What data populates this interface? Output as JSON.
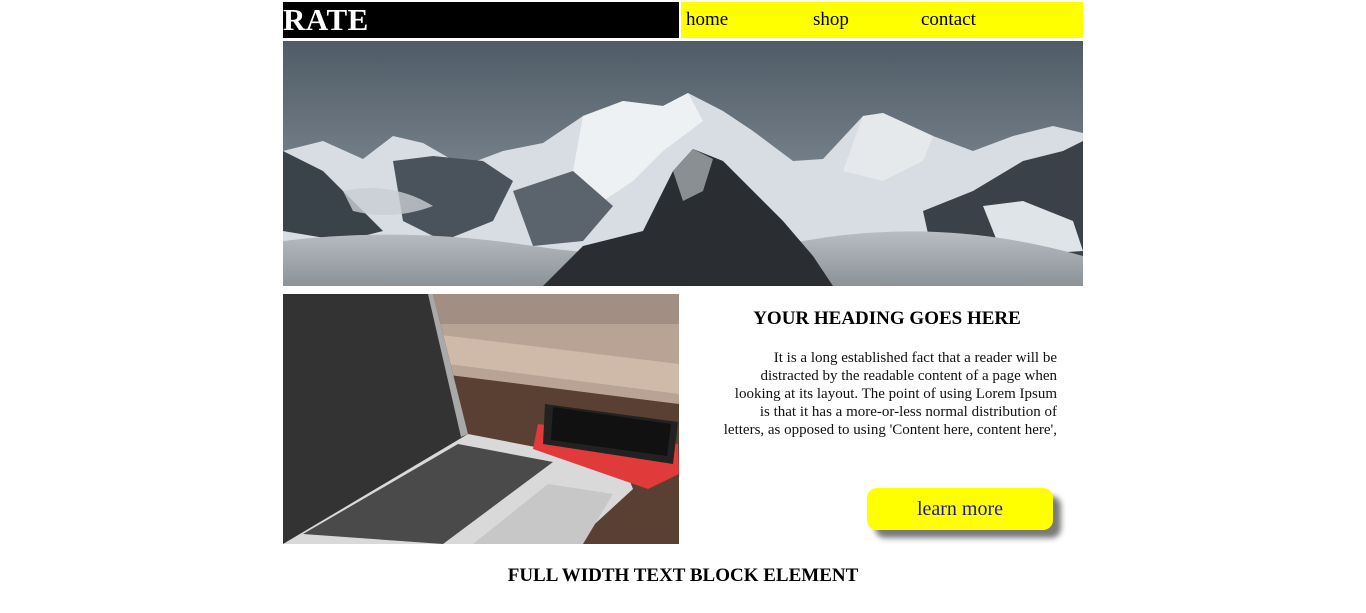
{
  "brand": {
    "logo_text": "RATE"
  },
  "nav": {
    "items": [
      {
        "label": "home"
      },
      {
        "label": "shop"
      },
      {
        "label": "contact"
      }
    ]
  },
  "hero": {
    "image": "snowy-mountains-photo"
  },
  "feature": {
    "image": "laptop-and-phone-photo",
    "heading": "YOUR HEADING GOES HERE",
    "body": "It is a long established fact that a reader will be distracted by the readable content of a page when looking at its layout. The point of using Lorem Ipsum is that it has a more-or-less normal distribution of letters, as opposed to using 'Content here, content here',",
    "button_label": "learn more"
  },
  "footer_block": {
    "heading": "FULL WIDTH TEXT BLOCK ELEMENT"
  },
  "colors": {
    "nav_background": "#ffff00",
    "logo_background": "#000000",
    "button_background": "#ffff00",
    "button_text": "#1a1aa0"
  }
}
